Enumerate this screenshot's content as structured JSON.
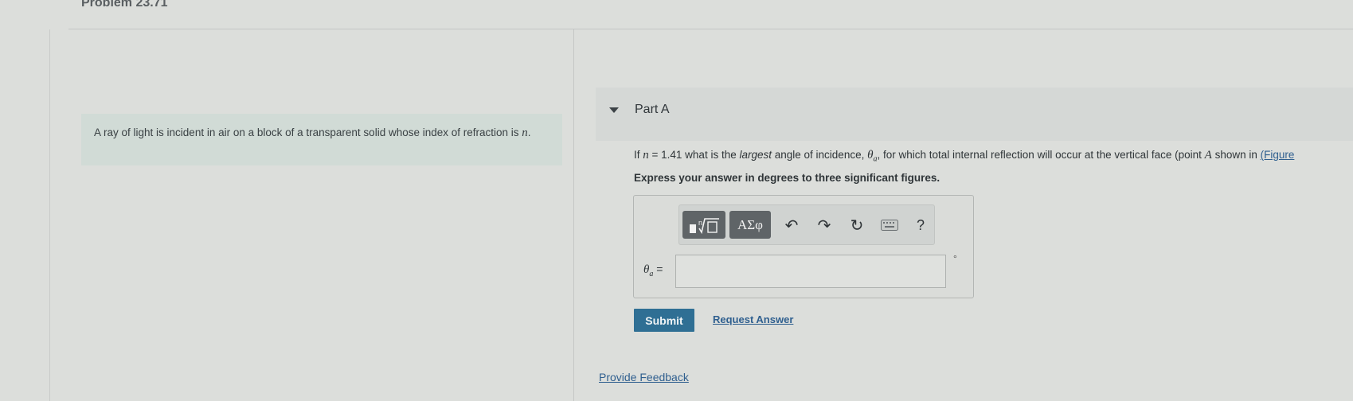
{
  "header": {
    "title": "Problem 23.71"
  },
  "intro": {
    "text_before": "A ray of light is incident in air on a block of a transparent solid whose index of refraction is ",
    "variable": "n",
    "text_after": "."
  },
  "part": {
    "label": "Part A",
    "question": {
      "t1": "If ",
      "var_n": "n",
      "t2": " = 1.41 what is the ",
      "emph": "largest",
      "t3": " angle of incidence, ",
      "var_theta": "θ",
      "sub_a": "a",
      "t4": ", for which total internal reflection will occur at the vertical face (point ",
      "var_A": "A",
      "t5": " shown in ",
      "link": "(Figure"
    },
    "instructions": "Express your answer in degrees to three significant figures."
  },
  "toolbar": {
    "greek_label": "ΑΣφ",
    "undo_glyph": "↶",
    "redo_glyph": "↷",
    "reset_glyph": "↻",
    "help_label": "?"
  },
  "answer": {
    "var_symbol": "θ",
    "var_sub": "a",
    "equals": " =",
    "value": "",
    "unit": "°"
  },
  "actions": {
    "submit_label": "Submit",
    "request_label": "Request Answer",
    "feedback_label": "Provide Feedback"
  },
  "icons": {
    "collapse": "chevron-down-icon",
    "templates": "templates-icon",
    "undo": "undo-icon",
    "redo": "redo-icon",
    "reset": "reset-icon",
    "keyboard": "keyboard-icon",
    "help": "help-icon"
  },
  "colors": {
    "submit": "#2f6f94",
    "link": "#2f5f8f",
    "intro_background": "#d1dbd6",
    "toolbar_button": "#5f6467"
  }
}
